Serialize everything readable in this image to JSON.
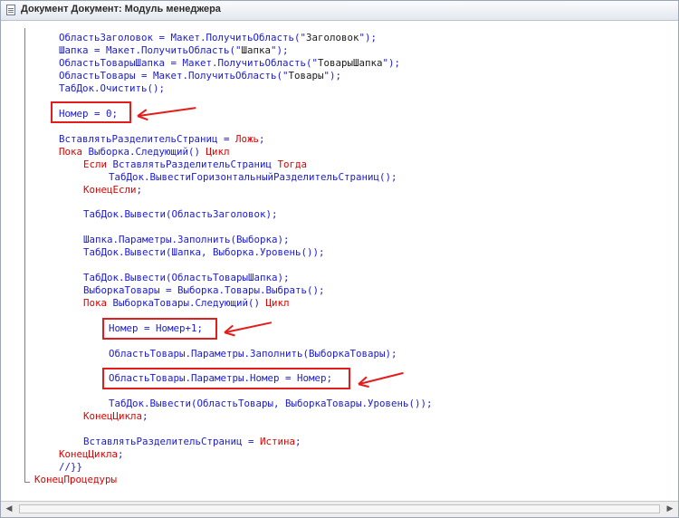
{
  "window": {
    "title": "Документ Документ: Модуль менеджера",
    "icon": "document-icon"
  },
  "colors": {
    "keyword": "#e00000",
    "identifier": "#1a1ad6",
    "string": "#1a1a1a",
    "highlight": "#e31c1c"
  },
  "code": [
    {
      "segs": [
        [
          "i",
          "ОбластьЗаголовок = Макет.ПолучитьОбласть(\""
        ],
        [
          "s",
          "Заголовок"
        ],
        [
          "i",
          "\");"
        ]
      ]
    },
    {
      "segs": [
        [
          "i",
          "Шапка = Макет.ПолучитьОбласть(\""
        ],
        [
          "s",
          "Шапка"
        ],
        [
          "i",
          "\");"
        ]
      ]
    },
    {
      "segs": [
        [
          "i",
          "ОбластьТоварыШапка = Макет.ПолучитьОбласть(\""
        ],
        [
          "s",
          "ТоварыШапка"
        ],
        [
          "i",
          "\");"
        ]
      ]
    },
    {
      "segs": [
        [
          "i",
          "ОбластьТовары = Макет.ПолучитьОбласть(\""
        ],
        [
          "s",
          "Товары"
        ],
        [
          "i",
          "\");"
        ]
      ]
    },
    {
      "segs": [
        [
          "i",
          "ТабДок.Очистить();"
        ]
      ]
    },
    {
      "segs": [
        [
          "i",
          "Номер = 0;"
        ]
      ]
    },
    {
      "segs": [
        [
          "i",
          "ВставлятьРазделительСтраниц = "
        ],
        [
          "k",
          "Ложь"
        ],
        [
          "i",
          ";"
        ]
      ]
    },
    {
      "segs": [
        [
          "k",
          "Пока "
        ],
        [
          "i",
          "Выборка.Следующий() "
        ],
        [
          "k",
          "Цикл"
        ]
      ]
    },
    {
      "segs": [
        [
          "k",
          "Если "
        ],
        [
          "i",
          "ВставлятьРазделительСтраниц "
        ],
        [
          "k",
          "Тогда"
        ]
      ]
    },
    {
      "segs": [
        [
          "i",
          "ТабДок.ВывестиГоризонтальныйРазделительСтраниц();"
        ]
      ]
    },
    {
      "segs": [
        [
          "k",
          "КонецЕсли"
        ],
        [
          "i",
          ";"
        ]
      ]
    },
    {
      "segs": [
        [
          "i",
          "ТабДок.Вывести(ОбластьЗаголовок);"
        ]
      ]
    },
    {
      "segs": [
        [
          "i",
          "Шапка.Параметры.Заполнить(Выборка);"
        ]
      ]
    },
    {
      "segs": [
        [
          "i",
          "ТабДок.Вывести(Шапка, Выборка.Уровень());"
        ]
      ]
    },
    {
      "segs": [
        [
          "i",
          "ТабДок.Вывести(ОбластьТоварыШапка);"
        ]
      ]
    },
    {
      "segs": [
        [
          "i",
          "ВыборкаТовары = Выборка.Товары.Выбрать();"
        ]
      ]
    },
    {
      "segs": [
        [
          "k",
          "Пока "
        ],
        [
          "i",
          "ВыборкаТовары.Следующий() "
        ],
        [
          "k",
          "Цикл"
        ]
      ]
    },
    {
      "segs": [
        [
          "i",
          "Номер = Номер+1;"
        ]
      ]
    },
    {
      "segs": [
        [
          "i",
          "ОбластьТовары.Параметры.Заполнить(ВыборкаТовары);"
        ]
      ]
    },
    {
      "segs": [
        [
          "i",
          "ОбластьТовары.Параметры.Номер = Номер;"
        ]
      ]
    },
    {
      "segs": [
        [
          "i",
          "ТабДок.Вывести(ОбластьТовары, ВыборкаТовары.Уровень());"
        ]
      ]
    },
    {
      "segs": [
        [
          "k",
          "КонецЦикла"
        ],
        [
          "i",
          ";"
        ]
      ]
    },
    {
      "segs": [
        [
          "i",
          "ВставлятьРазделительСтраниц = "
        ],
        [
          "k",
          "Истина"
        ],
        [
          "i",
          ";"
        ]
      ]
    },
    {
      "segs": [
        [
          "k",
          "КонецЦикла"
        ],
        [
          "i",
          ";"
        ]
      ]
    },
    {
      "segs": [
        [
          "i",
          "//}}"
        ]
      ]
    },
    {
      "segs": [
        [
          "k",
          "КонецПроцедуры"
        ]
      ]
    }
  ]
}
